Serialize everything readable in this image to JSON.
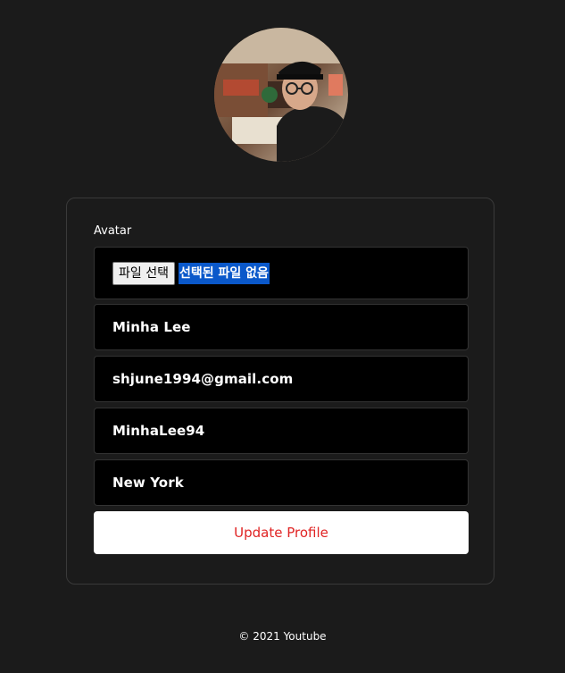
{
  "profile_photo": {
    "description_icon": "user-photo"
  },
  "form": {
    "avatar_label": "Avatar",
    "file_button_label": "파일 선택",
    "file_status": "선택된 파일 없음",
    "name_value": "Minha Lee",
    "email_value": "shjune1994@gmail.com",
    "username_value": "MinhaLee94",
    "location_value": "New York",
    "submit_label": "Update Profile"
  },
  "footer": {
    "text": "© 2021 Youtube"
  },
  "colors": {
    "background": "#1b1b1b",
    "field_background": "#000000",
    "submit_text": "#e02424",
    "file_status_highlight": "#0a58ca"
  }
}
